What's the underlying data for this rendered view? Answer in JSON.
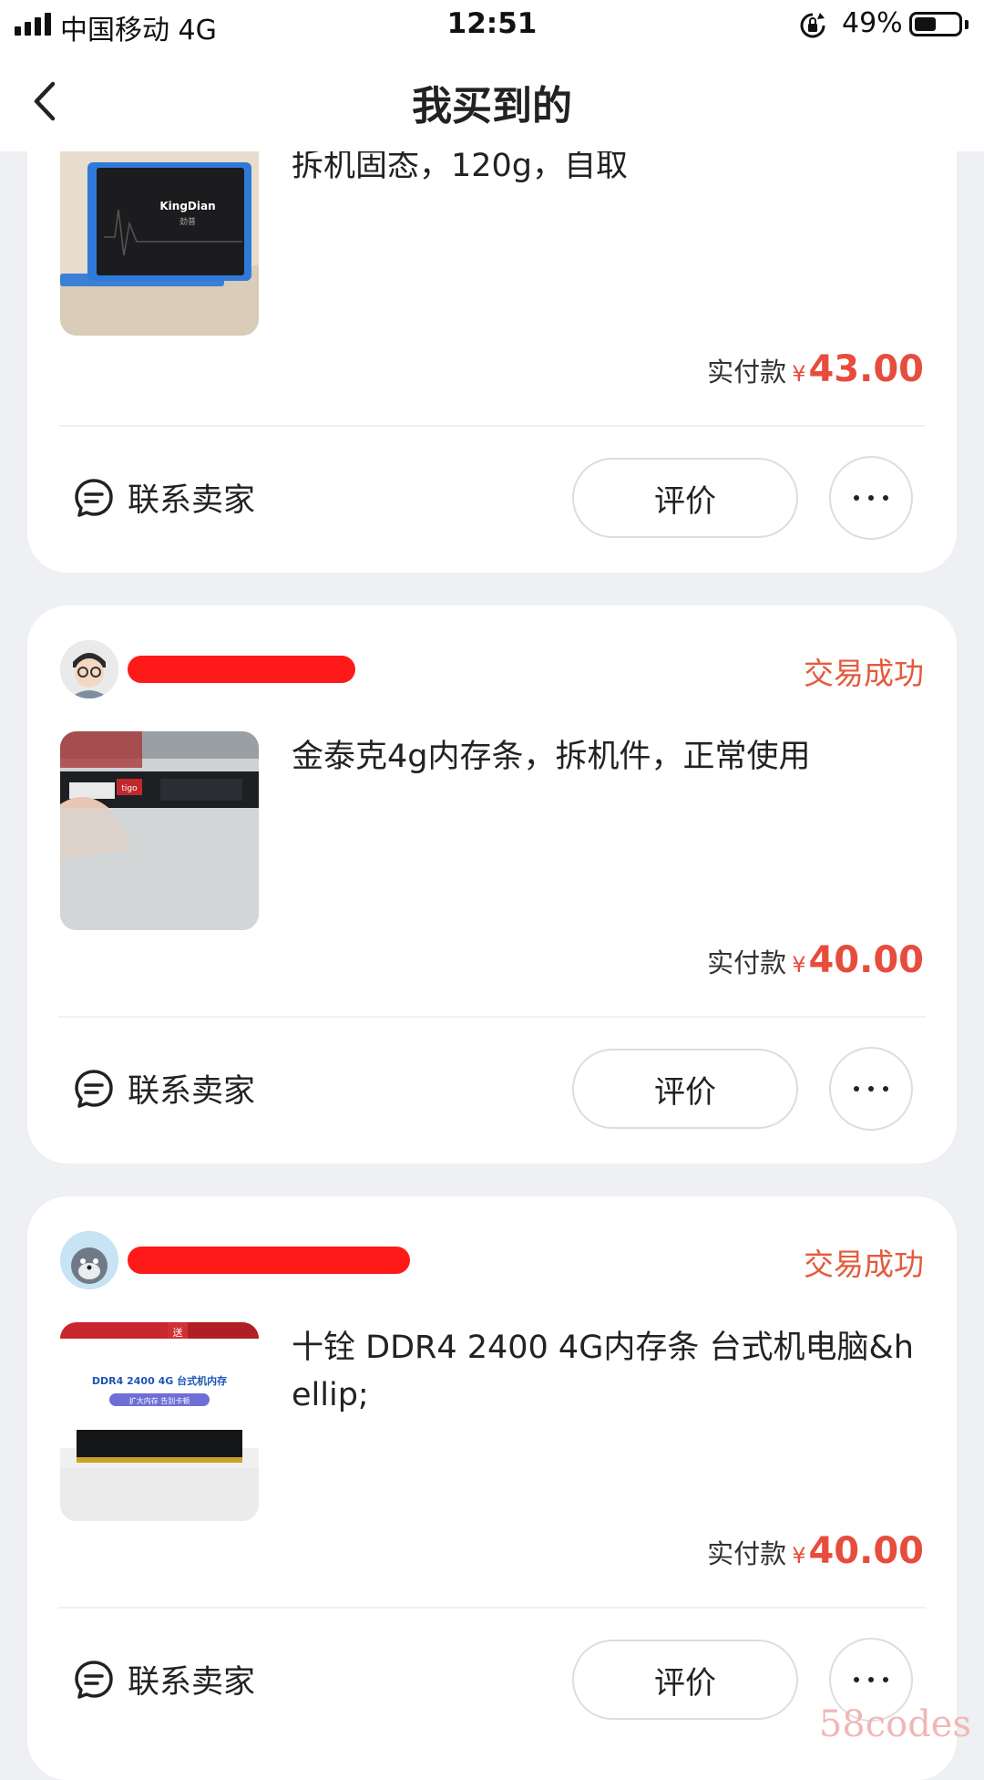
{
  "status_bar": {
    "carrier": "中国移动  4G",
    "time": "12:51",
    "battery_pct": "49%",
    "battery_level": 0.49
  },
  "nav": {
    "title": "我买到的"
  },
  "orders": [
    {
      "title": "拆机固态，120g，自取",
      "thumb_brand": "KingDian",
      "thumb_sub": "劲普",
      "pay_label": "实付款",
      "currency": "¥",
      "amount": "43.00",
      "contact_label": "联系卖家",
      "review_label": "评价"
    },
    {
      "status": "交易成功",
      "title": "金泰克4g内存条，拆机件，正常使用",
      "thumb_brand": "tigo",
      "pay_label": "实付款",
      "currency": "¥",
      "amount": "40.00",
      "contact_label": "联系卖家",
      "review_label": "评价"
    },
    {
      "status": "交易成功",
      "title": "十铨 DDR4 2400 4G内存条 台式机电脑&hellip;",
      "thumb_line1": "DDR4 2400 4G 台式机内存",
      "thumb_line2": "扩大内存  告别卡顿",
      "thumb_badge": "送",
      "pay_label": "实付款",
      "currency": "¥",
      "amount": "40.00",
      "contact_label": "联系卖家",
      "review_label": "评价"
    }
  ],
  "watermark": "58codes",
  "colors": {
    "accent": "#e74c3c",
    "status": "#e55a3c",
    "background": "#eef0f3"
  }
}
